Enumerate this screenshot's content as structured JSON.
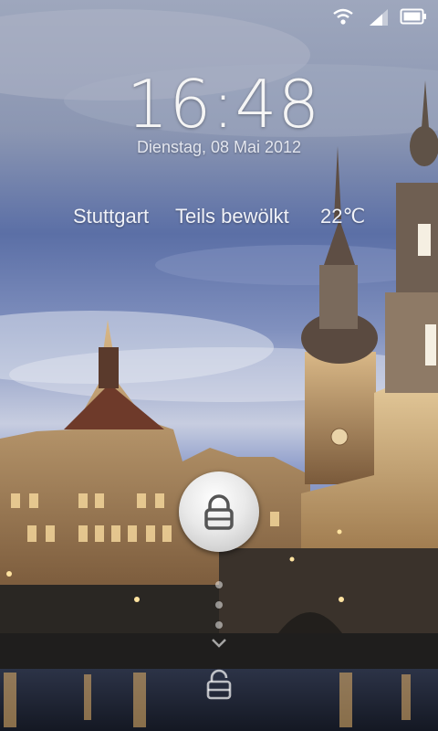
{
  "status_bar": {
    "icons": [
      "wifi-icon",
      "signal-icon",
      "battery-icon"
    ]
  },
  "lockscreen": {
    "time": "16:48",
    "date": "Dienstag, 08 Mai 2012",
    "weather": {
      "city": "Stuttgart",
      "condition": "Teils bewölkt",
      "temperature": "22℃"
    },
    "lock_icon": "lock-icon",
    "unlock_icon": "unlock-icon",
    "accent": "#ffffff"
  }
}
